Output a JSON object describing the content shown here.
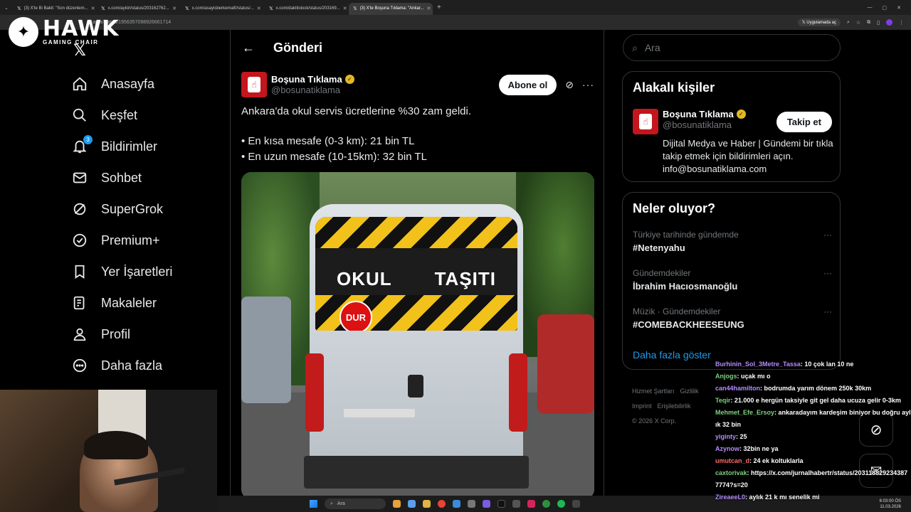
{
  "browser": {
    "tabs": [
      {
        "label": "(3) X'te Bi Bakit: \"Son düzenlem..."
      },
      {
        "label": "x.com/aykiri/status/203162762..."
      },
      {
        "label": "x.com/asayisberkemal0/status/..."
      },
      {
        "label": "x.com/daktilolock/status/203169..."
      },
      {
        "label": "(3) X'te Boşuna Tıklama: \"Ankar..."
      }
    ],
    "url": "ama/status/1956357098926661714",
    "open_in_app": "Uygulamada aç"
  },
  "overlay_logo": {
    "name": "HAWK",
    "subtitle": "GAMING CHAIR"
  },
  "sidebar": {
    "items": [
      {
        "label": "Anasayfa",
        "icon": "home-icon"
      },
      {
        "label": "Keşfet",
        "icon": "search-icon"
      },
      {
        "label": "Bildirimler",
        "icon": "bell-icon",
        "badge": "3"
      },
      {
        "label": "Sohbet",
        "icon": "mail-icon"
      },
      {
        "label": "SuperGrok",
        "icon": "grok-icon"
      },
      {
        "label": "Premium+",
        "icon": "premium-icon"
      },
      {
        "label": "Yer İşaretleri",
        "icon": "bookmark-icon"
      },
      {
        "label": "Makaleler",
        "icon": "articles-icon"
      },
      {
        "label": "Profil",
        "icon": "profile-icon"
      },
      {
        "label": "Daha fazla",
        "icon": "more-icon"
      }
    ]
  },
  "main": {
    "title": "Gönderi",
    "post": {
      "author": "Boşuna Tıklama",
      "handle": "@bosunatiklama",
      "subscribe_label": "Abone ol",
      "line1": "Ankara'da okul servis ücretlerine %30 zam geldi.",
      "line2": "• En kısa mesafe (0-3 km): 21 bin TL",
      "line3": "• En uzun mesafe (10-15km): 32 bin TL",
      "image_sign_left": "OKUL",
      "image_sign_right": "TAŞITI",
      "image_stop": "DUR"
    }
  },
  "right": {
    "search_placeholder": "Ara",
    "related": {
      "title": "Alakalı kişiler",
      "name": "Boşuna Tıklama",
      "handle": "@bosunatiklama",
      "follow_label": "Takip et",
      "bio": "Dijital Medya ve Haber | Gündemi bir tıkla takip etmek için bildirimleri açın. info@bosunatiklama.com"
    },
    "trends": {
      "title": "Neler oluyor?",
      "items": [
        {
          "meta": "Türkiye tarihinde gündemde",
          "name": "#Netenyahu"
        },
        {
          "meta": "Gündemdekiler",
          "name": "İbrahim Hacıosmanoğlu"
        },
        {
          "meta": "Müzik · Gündemdekiler",
          "name": "#COMEBACKHEESEUNG"
        }
      ],
      "show_more": "Daha fazla göster"
    },
    "footer": {
      "links": [
        "Hizmet Şartları",
        "Gizlilik",
        "Imprint",
        "Erişilebilirlik"
      ],
      "copyright": "© 2026 X Corp."
    }
  },
  "chat": [
    {
      "user": "Burhinin_Sol_3Metre_Tassa",
      "color": "#b58cff",
      "msg": ": 10 çok lan 10 ne"
    },
    {
      "user": "Anjogs",
      "color": "#7fd07f",
      "msg": ": uçak mı o"
    },
    {
      "user": "can44hamilton",
      "color": "#b58cff",
      "msg": ": bodrumda yarım dönem 250k 30km"
    },
    {
      "user": "Teqir",
      "color": "#7fd07f",
      "msg": ": 21.000 e hergün taksiyle git gel daha ucuza gelir 0-3km"
    },
    {
      "user": "Mehmet_Efe_Ersoy",
      "color": "#7fd07f",
      "msg": ": ankaradayım kardeşim biniyor bu doğru aylık 32 bin"
    },
    {
      "user": "yiginty",
      "color": "#b58cff",
      "msg": ": 25"
    },
    {
      "user": "Azynow",
      "color": "#b58cff",
      "msg": ": 32bin ne ya"
    },
    {
      "user": "umutcan_d",
      "color": "#ff6b6b",
      "msg": ": 24 ek koltuklarla"
    },
    {
      "user": "caxtorivak",
      "color": "#7fd07f",
      "msg": ": https://x.com/jurnalhabertr/status/2031188292343877774?s=20"
    },
    {
      "user": "ZireaeeL0",
      "color": "#b58cff",
      "msg": ": aylık 21 k mı senelik mi"
    }
  ],
  "taskbar": {
    "search_label": "Ara",
    "time": "6:03:00 ÖS",
    "date": "11.03.2026"
  },
  "colors": {
    "accent": "#1d9bf0",
    "verified": "#e5b922",
    "brand": "#c4161c"
  }
}
